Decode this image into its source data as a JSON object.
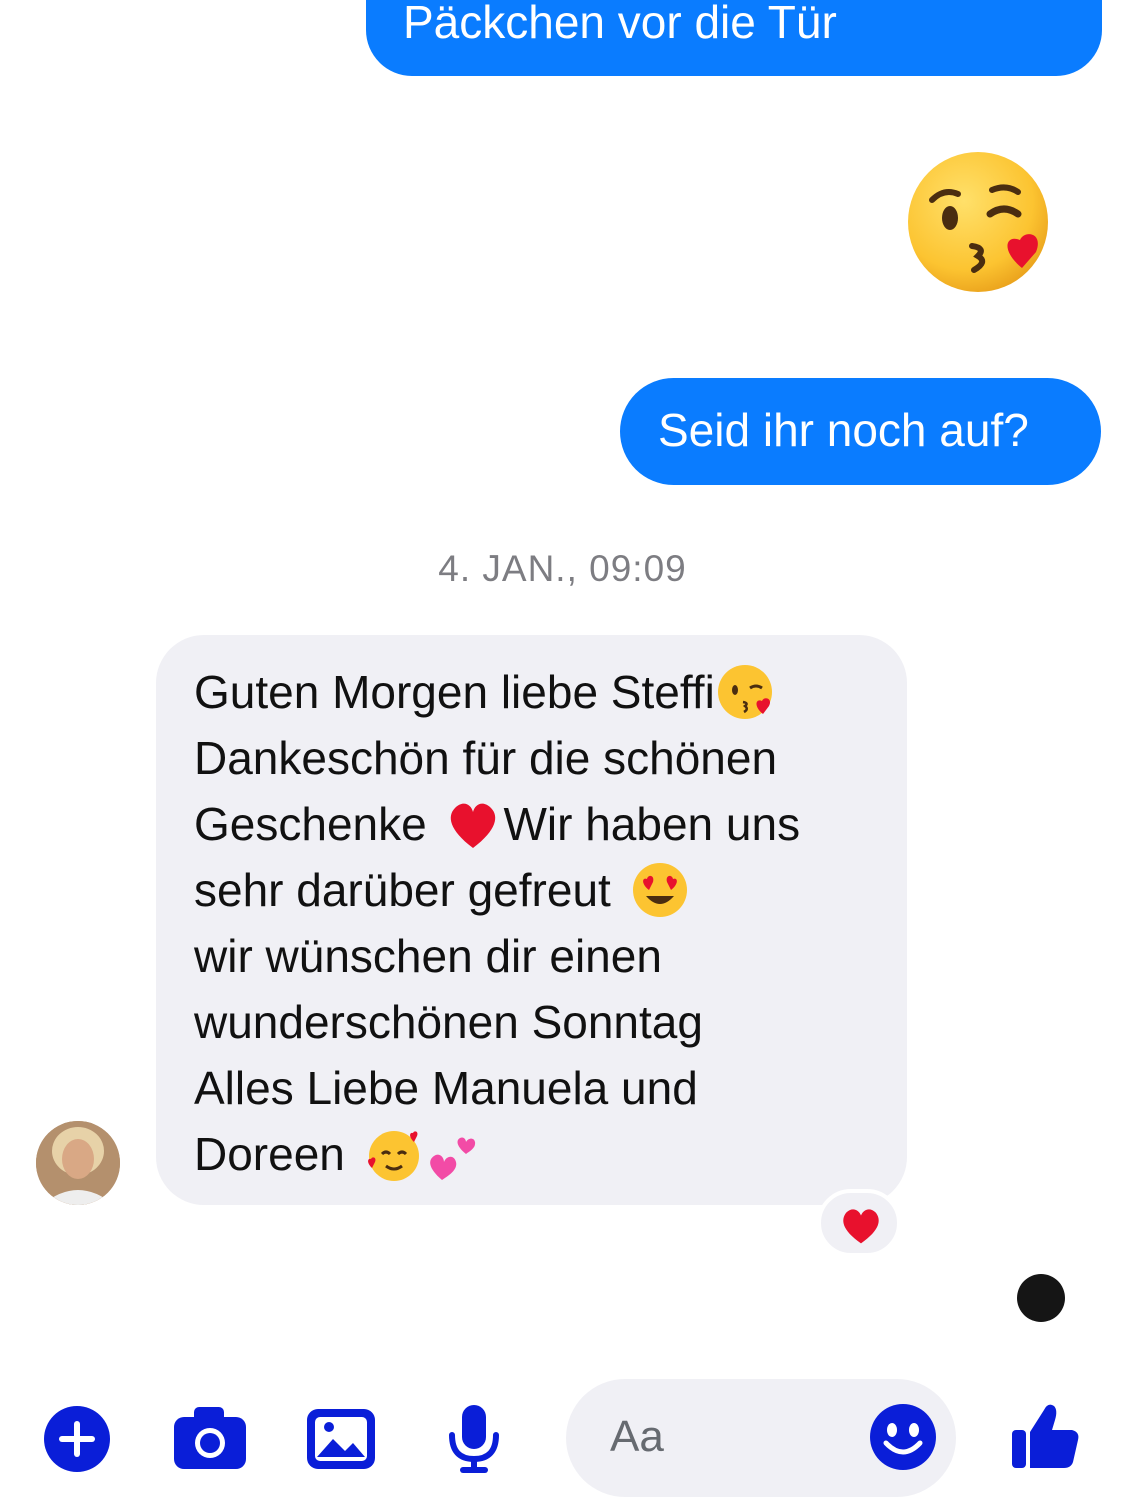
{
  "conversation": {
    "outgoing": [
      {
        "text": "Päckchen vor die Tür"
      },
      {
        "emoji": "kissing-heart-emoji"
      },
      {
        "text": "Seid ihr noch auf?"
      }
    ],
    "timestamp": "4. JAN., 09:09",
    "incoming": {
      "lines": [
        "Guten Morgen liebe Steffi",
        "Dankeschön für die schönen",
        "Geschenke",
        "Wir haben uns",
        "sehr darüber gefreut",
        "wir wünschen dir einen",
        "wunderschönen Sonntag",
        "Alles Liebe Manuela und",
        "Doreen"
      ],
      "reaction": "red-heart-emoji"
    }
  },
  "composer": {
    "placeholder": "Aa",
    "icons": [
      "plus-icon",
      "camera-icon",
      "gallery-icon",
      "microphone-icon",
      "smiley-icon",
      "thumbs-up-icon"
    ]
  },
  "colors": {
    "accent": "#0a7cff",
    "toolbar_icon": "#0a1ed8",
    "incoming_bubble": "#f0f0f5",
    "timestamp": "#7d7d82"
  }
}
